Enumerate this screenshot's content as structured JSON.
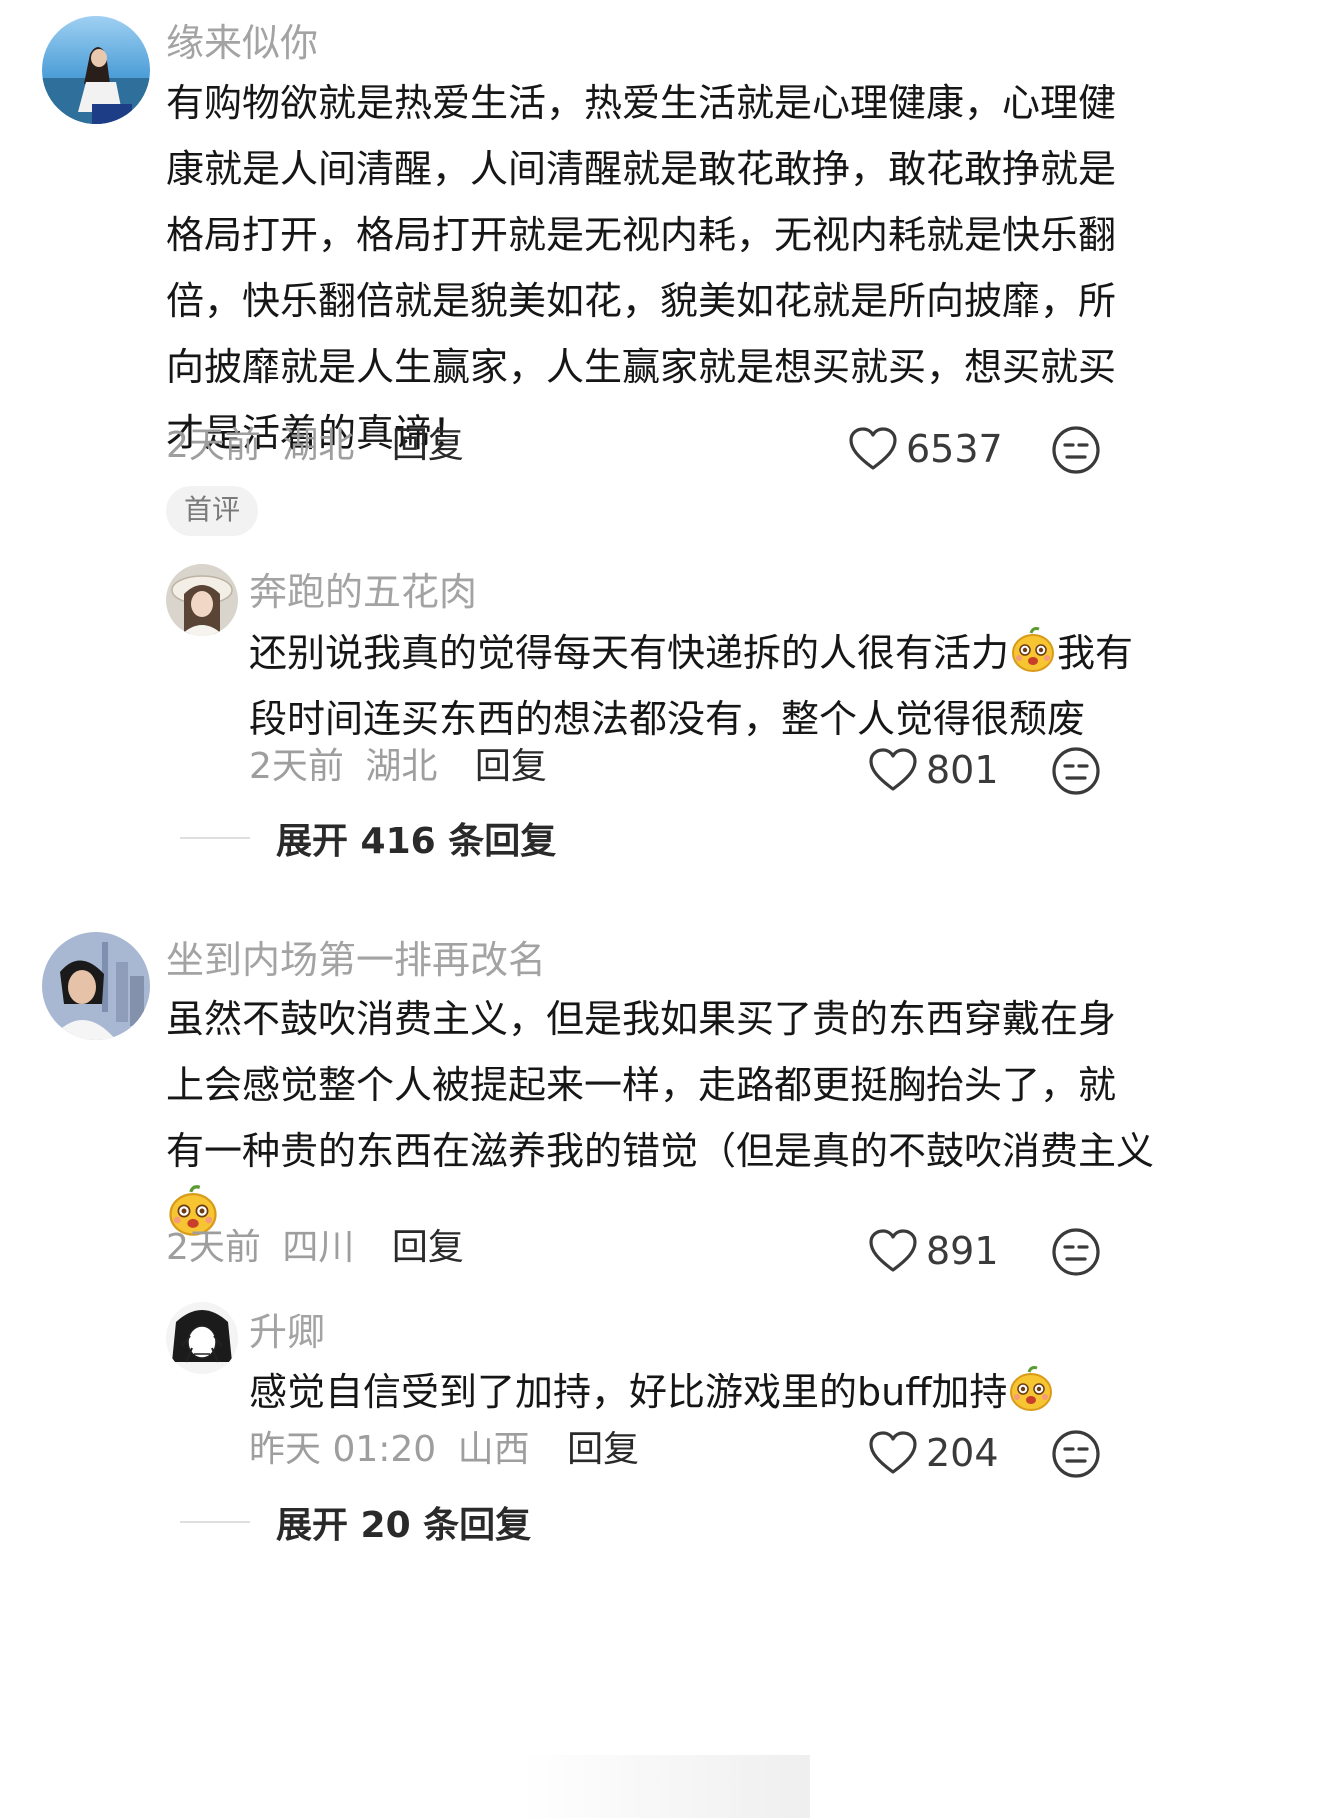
{
  "comments": [
    {
      "username": "缘来似你",
      "text_lines": [
        "有购物欲就是热爱生活，热爱生活就是心理健康，心理健",
        "康就是人间清醒，人间清醒就是敢花敢挣，敢花敢挣就是",
        "格局打开，格局打开就是无视内耗，无视内耗就是快乐翻",
        "倍，快乐翻倍就是貌美如花，貌美如花就是所向披靡，所",
        "向披靡就是人生赢家，人生赢家就是想买就买，想买就买",
        "才是活着的真谛！"
      ],
      "time": "2天前",
      "location": "湖北",
      "reply_label": "回复",
      "likes": "6537",
      "tag": "首评",
      "replies": [
        {
          "username": "奔跑的五花肉",
          "text_line1": "还别说我真的觉得每天有快递拆的人很有活力",
          "text_line1_tail": "我有",
          "text_line2": "段时间连买东西的想法都没有，整个人觉得很颓废",
          "time": "2天前",
          "location": "湖北",
          "reply_label": "回复",
          "likes": "801"
        }
      ],
      "expand_label": "展开 416 条回复"
    },
    {
      "username": "坐到内场第一排再改名",
      "text_lines": [
        "虽然不鼓吹消费主义，但是我如果买了贵的东西穿戴在身",
        "上会感觉整个人被提起来一样，走路都更挺胸抬头了，就",
        "有一种贵的东西在滋养我的错觉（但是真的不鼓吹消费主义"
      ],
      "time": "2天前",
      "location": "四川",
      "reply_label": "回复",
      "likes": "891",
      "replies": [
        {
          "username": "升卿",
          "text_line1": "感觉自信受到了加持，好比游戏里的buff加持",
          "time": "昨天 01:20",
          "location": "山西",
          "reply_label": "回复",
          "likes": "204"
        }
      ],
      "expand_label": "展开 20 条回复"
    }
  ],
  "colors": {
    "username": "#a3a3a3",
    "body": "#161616",
    "meta": "#9e9e9e",
    "tag_bg": "#f2f2f2"
  },
  "icons": [
    "heart-icon",
    "dislike-face-icon",
    "emoji-icon"
  ]
}
